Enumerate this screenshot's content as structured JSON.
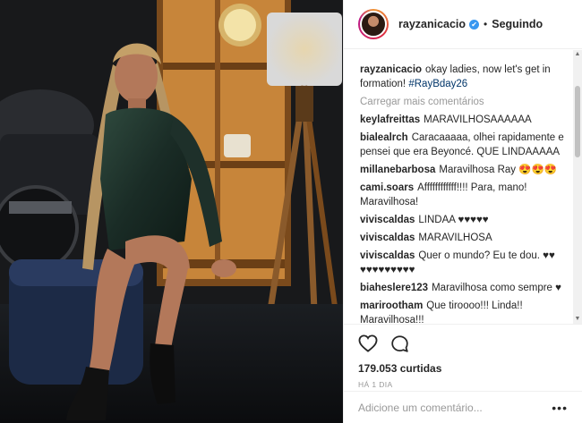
{
  "header": {
    "username": "rayzanicacio",
    "separator": "•",
    "follow_status": "Seguindo",
    "verified_glyph": "✔"
  },
  "caption": {
    "username": "rayzanicacio",
    "text": "okay ladies, now let's get in formation!",
    "hashtag": "#RayBday26"
  },
  "load_more": "Carregar mais comentários",
  "comments": [
    {
      "user": "keylafreittas",
      "text": "MARAVILHOSAAAAAA"
    },
    {
      "user": "bialealrch",
      "text": "Caracaaaaa, olhei rapidamente e pensei que era Beyoncé. QUE LINDAAAAA"
    },
    {
      "user": "millanebarbosa",
      "text": "Maravilhosa Ray 😍😍😍"
    },
    {
      "user": "cami.soars",
      "text": "Affffffffffff!!!! Para, mano! Maravilhosa!"
    },
    {
      "user": "viviscaldas",
      "text": "LINDAA ♥♥♥♥♥"
    },
    {
      "user": "viviscaldas",
      "text": "MARAVILHOSA"
    },
    {
      "user": "viviscaldas",
      "text": "Quer o mundo? Eu te dou. ♥♥ ♥♥♥♥♥♥♥♥♥"
    },
    {
      "user": "biaheslere123",
      "text": "Maravilhosa como sempre ♥"
    },
    {
      "user": "marirootham",
      "text": "Que tiroooo!!! Linda!! Maravilhosa!!!"
    }
  ],
  "likes_text": "179.053 curtidas",
  "time_text": "HÁ 1 DIA",
  "add_comment": {
    "placeholder": "Adicione um comentário..."
  },
  "more_glyph": "•••",
  "scroll": {
    "up": "▲",
    "down": "▼"
  },
  "icons": {
    "like": "heart-outline-icon",
    "comment": "speech-bubble-icon",
    "verified": "verified-badge-icon",
    "more": "more-options-icon"
  },
  "colors": {
    "link": "#003569",
    "verified": "#3897f0",
    "muted": "#999999",
    "border": "#efefef"
  }
}
